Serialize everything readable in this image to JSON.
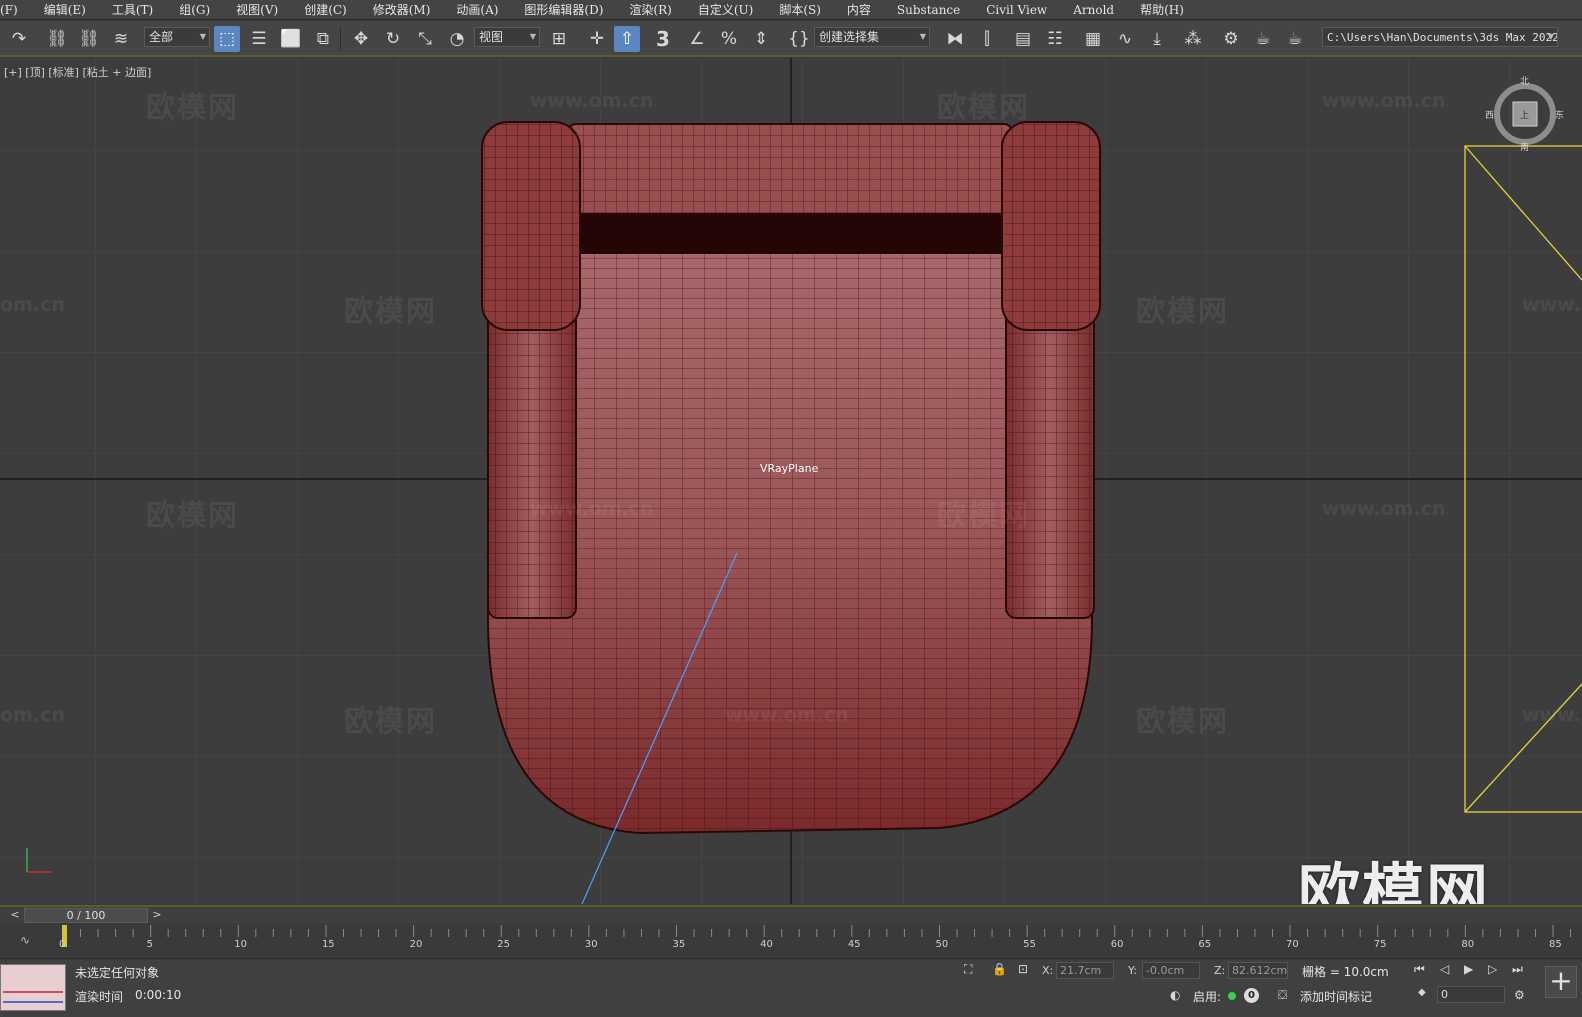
{
  "menu": [
    "(F)",
    "编辑(E)",
    "工具(T)",
    "组(G)",
    "视图(V)",
    "创建(C)",
    "修改器(M)",
    "动画(A)",
    "图形编辑器(D)",
    "渲染(R)",
    "自定义(U)",
    "脚本(S)",
    "内容",
    "Substance",
    "Civil View",
    "Arnold",
    "帮助(H)"
  ],
  "toolbar": {
    "selection_filter": "全部",
    "ref_coord": "视图",
    "selection_set": "创建选择集",
    "project_path": "C:\\Users\\Han\\Documents\\3ds Max 2022",
    "snap_label": "3"
  },
  "viewport": {
    "label": "[+] [顶] [标准] [粘土 + 边面]",
    "object_label": "VRayPlane",
    "watermark_cn": "欧模网",
    "watermark_url": "www.om.cn",
    "watermark_partial_left": "om.cn",
    "watermark_partial_right": "www.",
    "watermark_big": "欧模网",
    "viewcube": {
      "north": "北",
      "south": "南",
      "west": "西",
      "east": "东",
      "face": "上"
    },
    "colors": {
      "model": "#8e3b3c",
      "wire": "#2a0a0a",
      "grid": "#4d4d4d",
      "axis": "#111111",
      "selection_box": "#e6d23a",
      "camera_line": "#4aa0ff"
    }
  },
  "timeslider": {
    "position": "0 / 100",
    "prev": "<",
    "next": ">"
  },
  "trackbar": {
    "labels": [
      "0",
      "5",
      "10",
      "15",
      "20",
      "25",
      "30",
      "35",
      "40",
      "45",
      "50",
      "55",
      "60",
      "65",
      "70",
      "75",
      "80",
      "85"
    ]
  },
  "status": {
    "message": "未选定任何对象",
    "render_time_label": "渲染时间",
    "render_time": "0:00:10",
    "x_label": "X:",
    "x": "21.7cm",
    "y_label": "Y:",
    "y": "-0.0cm",
    "z_label": "Z:",
    "z": "82.612cm",
    "grid": "栅格 = 10.0cm",
    "enable": "启用:",
    "enable_count": "0",
    "add_time_tag": "添加时间标记",
    "frame": "0"
  }
}
